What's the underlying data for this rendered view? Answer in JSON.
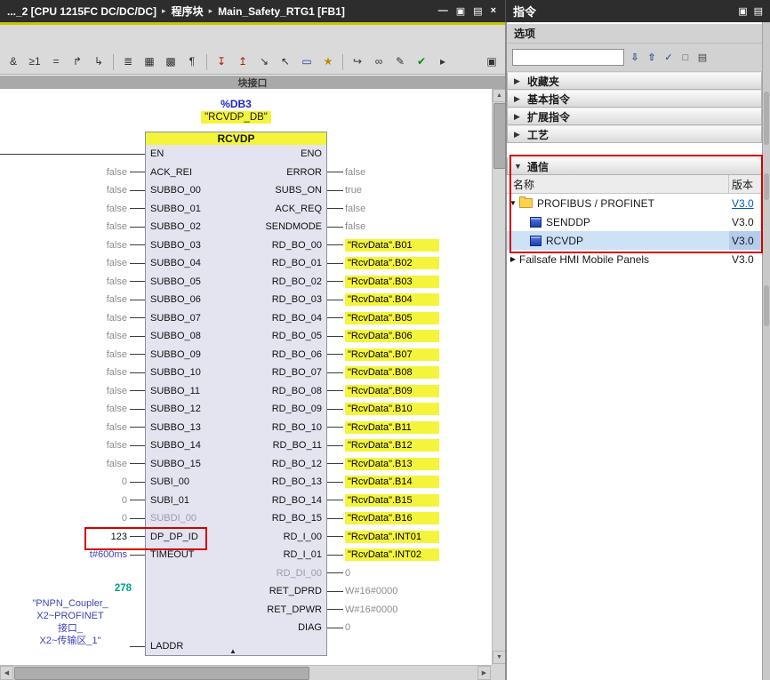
{
  "colors": {
    "highlight_yellow": "#f4f43c",
    "annotation_red": "#d40000",
    "selection_blue": "#cde1f7",
    "link_blue": "#0057c8"
  },
  "window": {
    "breadcrumb": [
      "..._2 [CPU 1215FC DC/DC/DC]",
      "程序块",
      "Main_Safety_RTG1 [FB1]"
    ],
    "controls": [
      {
        "name": "minimize-button",
        "glyph": "—"
      },
      {
        "name": "restore-button",
        "glyph": "▣"
      },
      {
        "name": "float-button",
        "glyph": "▤"
      },
      {
        "name": "close-button",
        "glyph": "×"
      }
    ]
  },
  "toolbar": {
    "groups": [
      [
        {
          "n": "insert-and-box-icon",
          "g": "&"
        },
        {
          "n": "insert-or-box-icon",
          "g": "≥1"
        },
        {
          "n": "insert-assignment-icon",
          "g": "="
        },
        {
          "n": "open-branch-icon",
          "g": "↱"
        },
        {
          "n": "close-branch-icon",
          "g": "↳"
        }
      ],
      [
        {
          "n": "insert-network-icon",
          "g": "≣"
        },
        {
          "n": "open-all-networks-icon",
          "g": "▦"
        },
        {
          "n": "close-all-networks-icon",
          "g": "▩"
        },
        {
          "n": "comment-icon",
          "g": "¶"
        }
      ],
      [
        {
          "n": "download-icon",
          "g": "↧",
          "c": "#b02000"
        },
        {
          "n": "upload-icon",
          "g": "↥",
          "c": "#b02000"
        },
        {
          "n": "insert-row-icon",
          "g": "↘"
        },
        {
          "n": "delete-row-icon",
          "g": "↖"
        },
        {
          "n": "insert-empty-box-icon",
          "g": "▭",
          "c": "#1a3f8f"
        },
        {
          "n": "favorites-icon",
          "g": "★",
          "c": "#c08a00"
        }
      ],
      [
        {
          "n": "goto-icon",
          "g": "↪"
        },
        {
          "n": "monitoring-glasses-icon",
          "g": "∞"
        },
        {
          "n": "edit-icon",
          "g": "✎"
        },
        {
          "n": "consistency-check-icon",
          "g": "✔",
          "c": "#0a8a0a"
        },
        {
          "n": "more-commands-icon",
          "g": "▸"
        }
      ]
    ],
    "right_icon": {
      "n": "detach-editor-icon",
      "g": "▣"
    }
  },
  "interface_bar": {
    "label": "块接口"
  },
  "diagram": {
    "db_address": "%DB3",
    "db_name": "\"RCVDP_DB\"",
    "block_title": "RCVDP",
    "rows": [
      {
        "l": "EN",
        "r": "ENO"
      },
      {
        "l": "ACK_REI",
        "lv": "false",
        "r": "ERROR",
        "rv": "false"
      },
      {
        "l": "SUBBO_00",
        "lv": "false",
        "r": "SUBS_ON",
        "rv": "true"
      },
      {
        "l": "SUBBO_01",
        "lv": "false",
        "r": "ACK_REQ",
        "rv": "false"
      },
      {
        "l": "SUBBO_02",
        "lv": "false",
        "r": "SENDMODE",
        "rv": "false"
      },
      {
        "l": "SUBBO_03",
        "lv": "false",
        "r": "RD_BO_00",
        "rv": "\"RcvData\".B01",
        "ry": true
      },
      {
        "l": "SUBBO_04",
        "lv": "false",
        "r": "RD_BO_01",
        "rv": "\"RcvData\".B02",
        "ry": true
      },
      {
        "l": "SUBBO_05",
        "lv": "false",
        "r": "RD_BO_02",
        "rv": "\"RcvData\".B03",
        "ry": true
      },
      {
        "l": "SUBBO_06",
        "lv": "false",
        "r": "RD_BO_03",
        "rv": "\"RcvData\".B04",
        "ry": true
      },
      {
        "l": "SUBBO_07",
        "lv": "false",
        "r": "RD_BO_04",
        "rv": "\"RcvData\".B05",
        "ry": true
      },
      {
        "l": "SUBBO_08",
        "lv": "false",
        "r": "RD_BO_05",
        "rv": "\"RcvData\".B06",
        "ry": true
      },
      {
        "l": "SUBBO_09",
        "lv": "false",
        "r": "RD_BO_06",
        "rv": "\"RcvData\".B07",
        "ry": true
      },
      {
        "l": "SUBBO_10",
        "lv": "false",
        "r": "RD_BO_07",
        "rv": "\"RcvData\".B08",
        "ry": true
      },
      {
        "l": "SUBBO_11",
        "lv": "false",
        "r": "RD_BO_08",
        "rv": "\"RcvData\".B09",
        "ry": true
      },
      {
        "l": "SUBBO_12",
        "lv": "false",
        "r": "RD_BO_09",
        "rv": "\"RcvData\".B10",
        "ry": true
      },
      {
        "l": "SUBBO_13",
        "lv": "false",
        "r": "RD_BO_10",
        "rv": "\"RcvData\".B11",
        "ry": true
      },
      {
        "l": "SUBBO_14",
        "lv": "false",
        "r": "RD_BO_11",
        "rv": "\"RcvData\".B12",
        "ry": true
      },
      {
        "l": "SUBBO_15",
        "lv": "false",
        "r": "RD_BO_12",
        "rv": "\"RcvData\".B13",
        "ry": true
      },
      {
        "l": "SUBI_00",
        "lv": "0",
        "r": "RD_BO_13",
        "rv": "\"RcvData\".B14",
        "ry": true
      },
      {
        "l": "SUBI_01",
        "lv": "0",
        "r": "RD_BO_14",
        "rv": "\"RcvData\".B15",
        "ry": true
      },
      {
        "l": "SUBDI_00",
        "lv": "0",
        "lg": true,
        "r": "RD_BO_15",
        "rv": "\"RcvData\".B16",
        "ry": true
      },
      {
        "l": "DP_DP_ID",
        "lv": "123",
        "lvc": "dark",
        "red": true,
        "r": "RD_I_00",
        "rv": "\"RcvData\".INT01",
        "ry": true
      },
      {
        "l": "TIMEOUT",
        "lv": "t#600ms",
        "lvc": "blue",
        "r": "RD_I_01",
        "rv": "\"RcvData\".INT02",
        "ry": true
      },
      {
        "r": "RD_DI_00",
        "rv": "0",
        "rg": true
      },
      {
        "r": "RET_DPRD",
        "rv": "W#16#0000"
      },
      {
        "r": "RET_DPWR",
        "rv": "W#16#0000"
      },
      {
        "r": "DIAG",
        "rv": "0"
      },
      {
        "l": "LADDR"
      }
    ],
    "laddr_value": "278",
    "laddr_operand_lines": [
      "\"PNPN_Coupler_",
      "X2~PROFINET",
      "接口_",
      "X2~传输区_1\""
    ]
  },
  "panel": {
    "title": "指令",
    "header_icons": [
      {
        "name": "panel-float-icon",
        "glyph": "▣"
      },
      {
        "name": "panel-collapse-icon",
        "glyph": "▤"
      }
    ],
    "options_label": "选项",
    "search": {
      "value": "",
      "icons": [
        {
          "name": "profile-filter-down-icon",
          "glyph": "⇩",
          "plain": false
        },
        {
          "name": "profile-filter-up-icon",
          "glyph": "⇧",
          "plain": false
        },
        {
          "name": "filter-check-icon",
          "glyph": "✓",
          "plain": false
        },
        {
          "name": "view-panes-icon",
          "glyph": "□",
          "plain": true
        },
        {
          "name": "view-list-icon",
          "glyph": "▤",
          "plain": true
        }
      ]
    },
    "sections": [
      {
        "id": "favorites",
        "label": "收藏夹",
        "expanded": false
      },
      {
        "id": "basic",
        "label": "基本指令",
        "expanded": false
      },
      {
        "id": "extended",
        "label": "扩展指令",
        "expanded": false
      },
      {
        "id": "technology",
        "label": "工艺",
        "expanded": false
      },
      {
        "id": "communication",
        "label": "通信",
        "expanded": true
      }
    ],
    "columns": {
      "name": "名称",
      "version": "版本"
    },
    "tree": [
      {
        "name": "profibus-profinet",
        "label": "PROFIBUS / PROFINET",
        "version": "V3.0",
        "icon": "folder",
        "arrow": "expanded",
        "indent": 0,
        "version_link": true
      },
      {
        "name": "senddp",
        "label": "SENDDP",
        "version": "V3.0",
        "icon": "fb",
        "indent": 1
      },
      {
        "name": "rcvdp",
        "label": "RCVDP",
        "version": "V3.0",
        "icon": "fb",
        "indent": 1,
        "selected": true
      },
      {
        "name": "failsafe-hmi-mobile-panels",
        "label": "Failsafe HMI Mobile Panels",
        "version": "V3.0",
        "arrow": "collapsed",
        "indent": 0
      }
    ]
  }
}
